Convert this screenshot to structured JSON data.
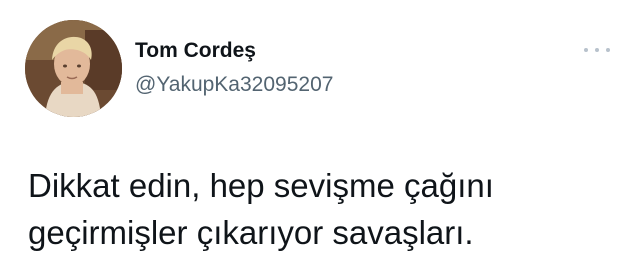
{
  "tweet": {
    "author": {
      "display_name": "Tom Cordeş",
      "handle": "@YakupKa32095207",
      "avatar_icon": "profile-photo"
    },
    "more_icon": "ellipsis-icon",
    "text_lines": [
      "Dikkat edin, hep sevişme çağını",
      "geçirmişler çıkarıyor savaşları."
    ]
  },
  "colors": {
    "background": "#ffffff",
    "text_primary": "#0f1419",
    "text_secondary": "#536471",
    "icon_muted": "#b8c2cc"
  }
}
